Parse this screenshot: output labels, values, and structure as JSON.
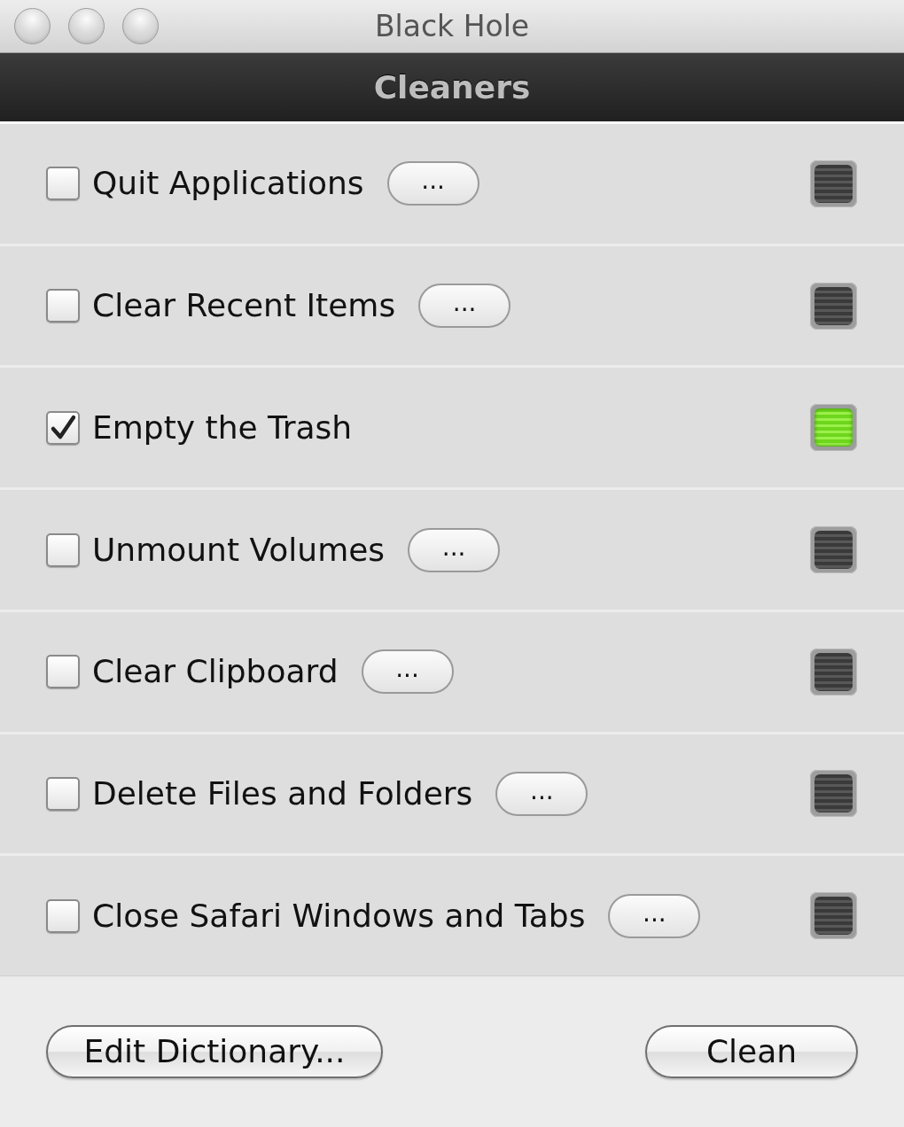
{
  "window": {
    "title": "Black Hole"
  },
  "header": {
    "title": "Cleaners"
  },
  "cleaners": [
    {
      "label": "Quit Applications",
      "checked": false,
      "options_button": "...",
      "lit": false
    },
    {
      "label": "Clear Recent Items",
      "checked": false,
      "options_button": "...",
      "lit": false
    },
    {
      "label": "Empty the Trash",
      "checked": true,
      "lit": true
    },
    {
      "label": "Unmount Volumes",
      "checked": false,
      "options_button": "...",
      "lit": false
    },
    {
      "label": "Clear Clipboard",
      "checked": false,
      "options_button": "...",
      "lit": false
    },
    {
      "label": "Delete Files and Folders",
      "checked": false,
      "options_button": "...",
      "lit": false
    },
    {
      "label": "Close Safari Windows and Tabs",
      "checked": false,
      "options_button": "...",
      "lit": false
    }
  ],
  "buttons": [
    {
      "label": "Edit Dictionary..."
    },
    {
      "label": "Clean"
    }
  ]
}
